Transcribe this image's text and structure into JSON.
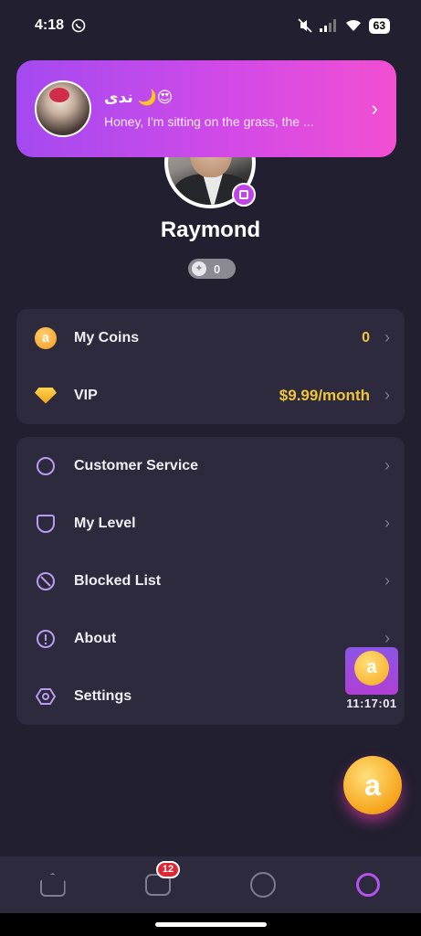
{
  "status_bar": {
    "time": "4:18",
    "battery": "63",
    "icons": [
      "whatsapp-icon",
      "mute-icon",
      "signal-icon",
      "wifi-icon",
      "battery-icon"
    ]
  },
  "notification": {
    "sender_name": "ندى 🌙😍",
    "message": "Honey, I'm sitting on the grass, the ..."
  },
  "profile": {
    "username": "Raymond",
    "badge_count": "0"
  },
  "wallet_menu": {
    "items": [
      {
        "label": "My Coins",
        "value": "0",
        "icon": "coin-icon"
      },
      {
        "label": "VIP",
        "value": "$9.99/month",
        "icon": "diamond-icon"
      }
    ]
  },
  "settings_menu": {
    "items": [
      {
        "label": "Customer Service",
        "icon": "customer-service-icon"
      },
      {
        "label": "My Level",
        "icon": "level-shield-icon"
      },
      {
        "label": "Blocked List",
        "icon": "blocked-icon"
      },
      {
        "label": "About",
        "icon": "info-icon"
      },
      {
        "label": "Settings",
        "icon": "settings-icon"
      }
    ]
  },
  "treasure_timer": "11:17:01",
  "bottom_nav": {
    "items": [
      {
        "name": "home",
        "icon": "home-icon"
      },
      {
        "name": "messages",
        "icon": "chat-icon",
        "badge": "12"
      },
      {
        "name": "play",
        "icon": "play-icon"
      },
      {
        "name": "me",
        "icon": "profile-icon",
        "active": true
      }
    ]
  },
  "colors": {
    "background": "#221f30",
    "card": "#2d2a3d",
    "accent": "#c044e6",
    "gold": "#f0c53a"
  }
}
